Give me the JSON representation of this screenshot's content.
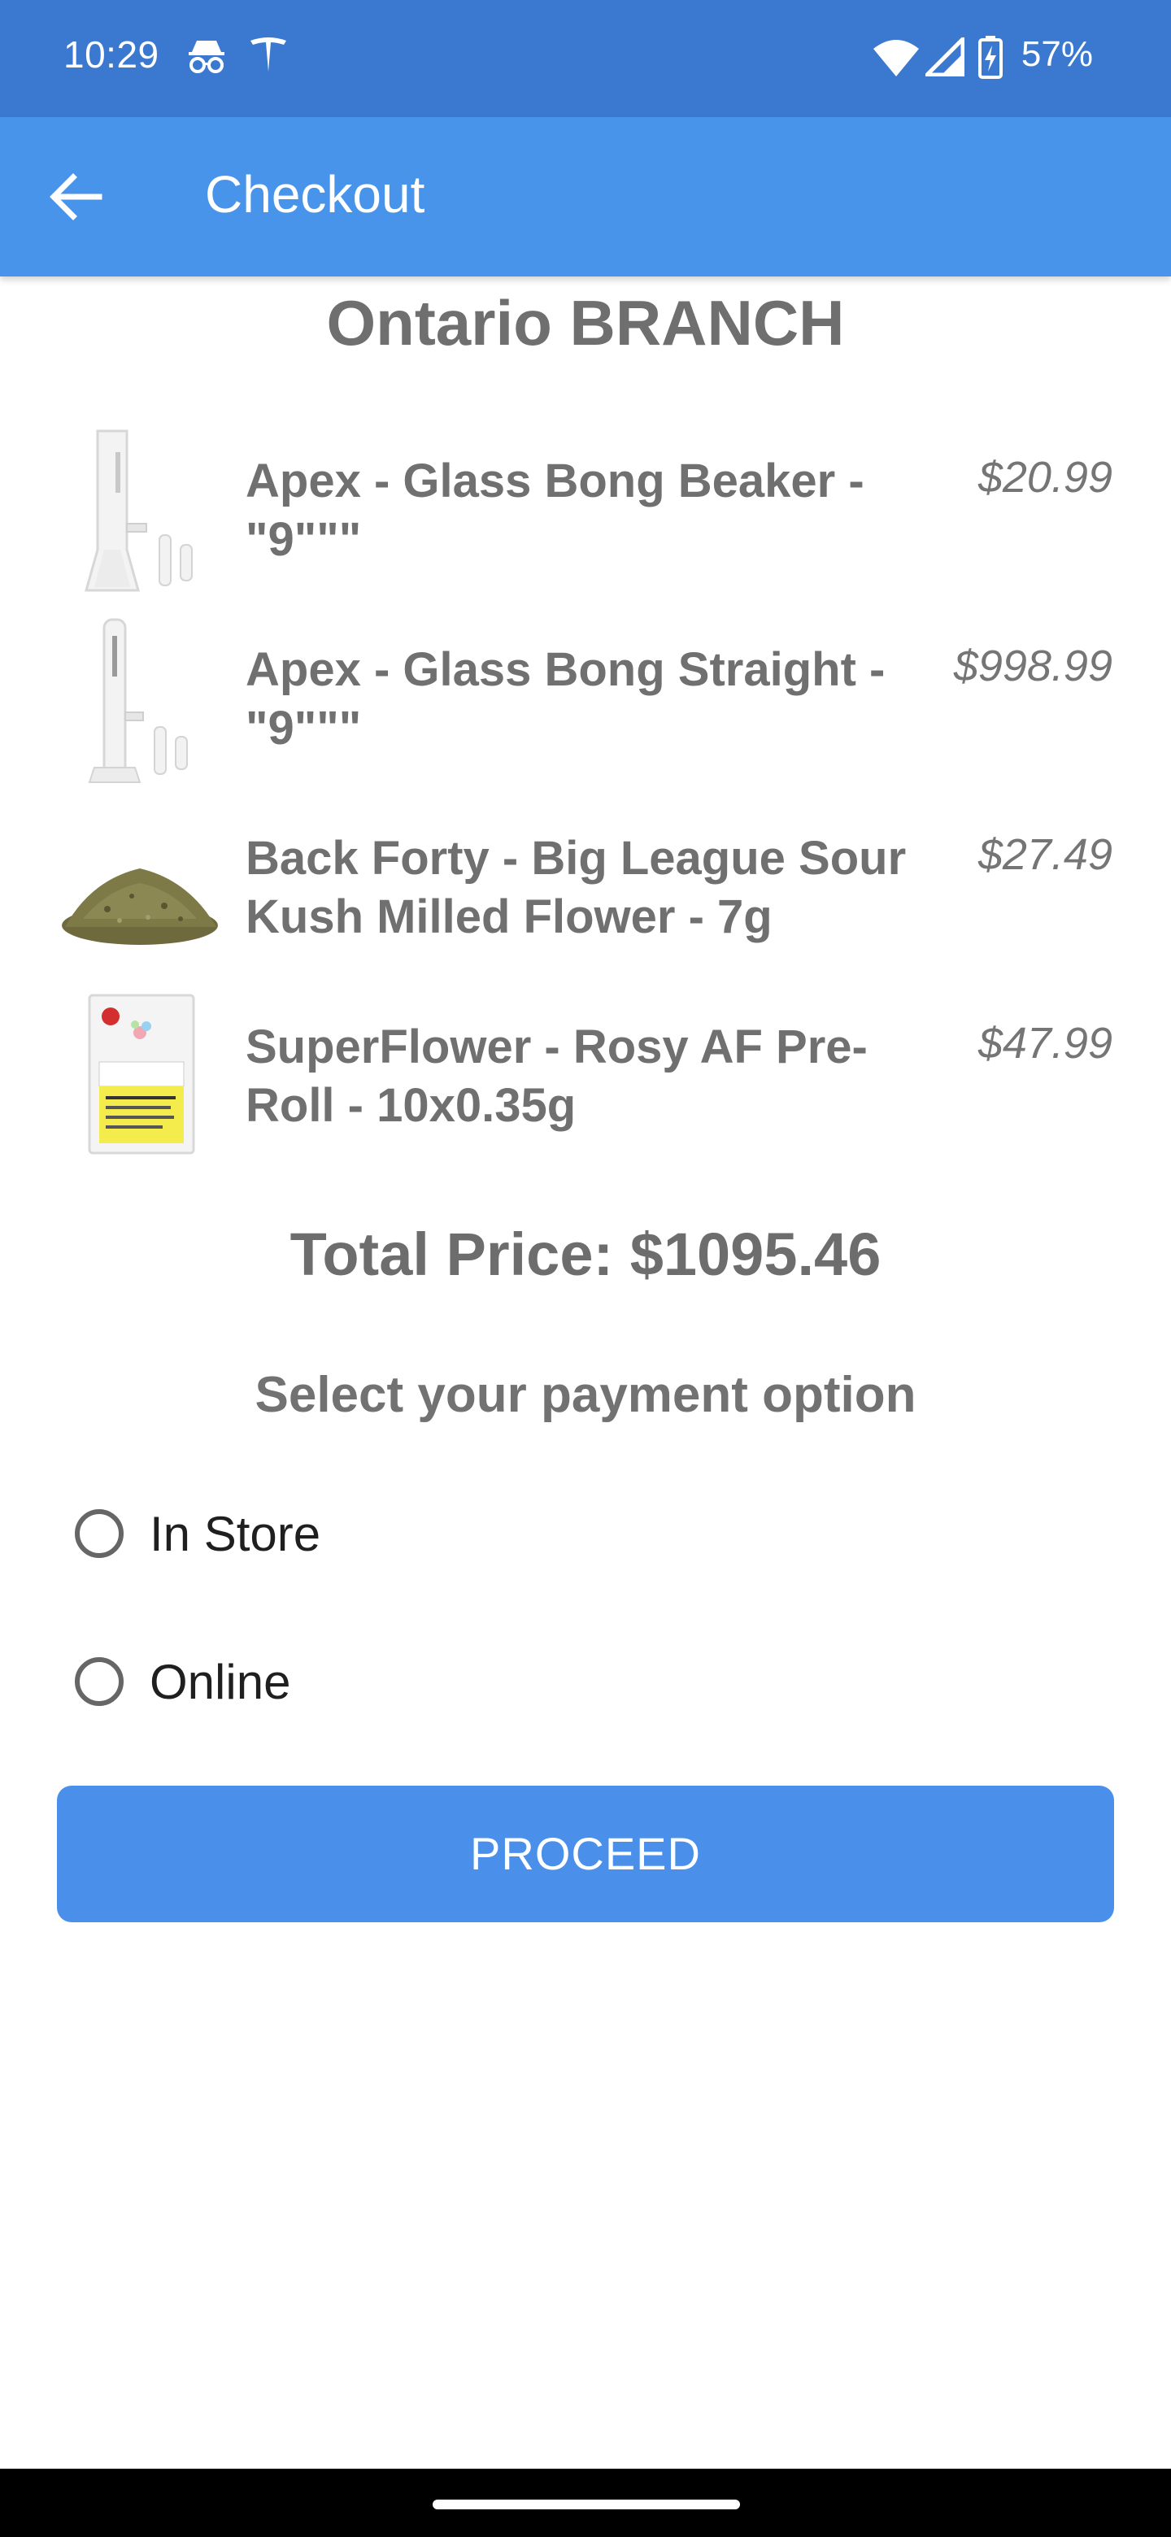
{
  "status_bar": {
    "time": "10:29",
    "battery": "57%",
    "icons": [
      "incognito-icon",
      "tesla-icon",
      "wifi-icon",
      "signal-icon",
      "battery-charging-icon"
    ]
  },
  "app_bar": {
    "title": "Checkout",
    "back_icon": "arrow-left-icon"
  },
  "branch": {
    "title": "Ontario BRANCH"
  },
  "items": [
    {
      "name": "Apex - Glass Bong Beaker - \"9\"\"\"",
      "price": "$20.99",
      "thumb": "glass-bong-beaker"
    },
    {
      "name": "Apex - Glass Bong Straight - \"9\"\"\"",
      "price": "$998.99",
      "thumb": "glass-bong-straight"
    },
    {
      "name": "Back Forty - Big League Sour Kush Milled Flower - 7g",
      "price": "$27.49",
      "thumb": "milled-flower"
    },
    {
      "name": "SuperFlower - Rosy AF Pre-Roll - 10x0.35g",
      "price": "$47.99",
      "thumb": "pre-roll-package"
    }
  ],
  "total": {
    "label": "Total Price: $1095.46"
  },
  "payment": {
    "heading": "Select your payment option",
    "options": [
      {
        "label": "In Store",
        "selected": false
      },
      {
        "label": "Online",
        "selected": false
      }
    ]
  },
  "proceed": {
    "label": "PROCEED"
  },
  "colors": {
    "status_bar": "#3b79d1",
    "app_bar": "#4894eb",
    "button": "#4a8fe9",
    "text_gray": "#707070"
  }
}
